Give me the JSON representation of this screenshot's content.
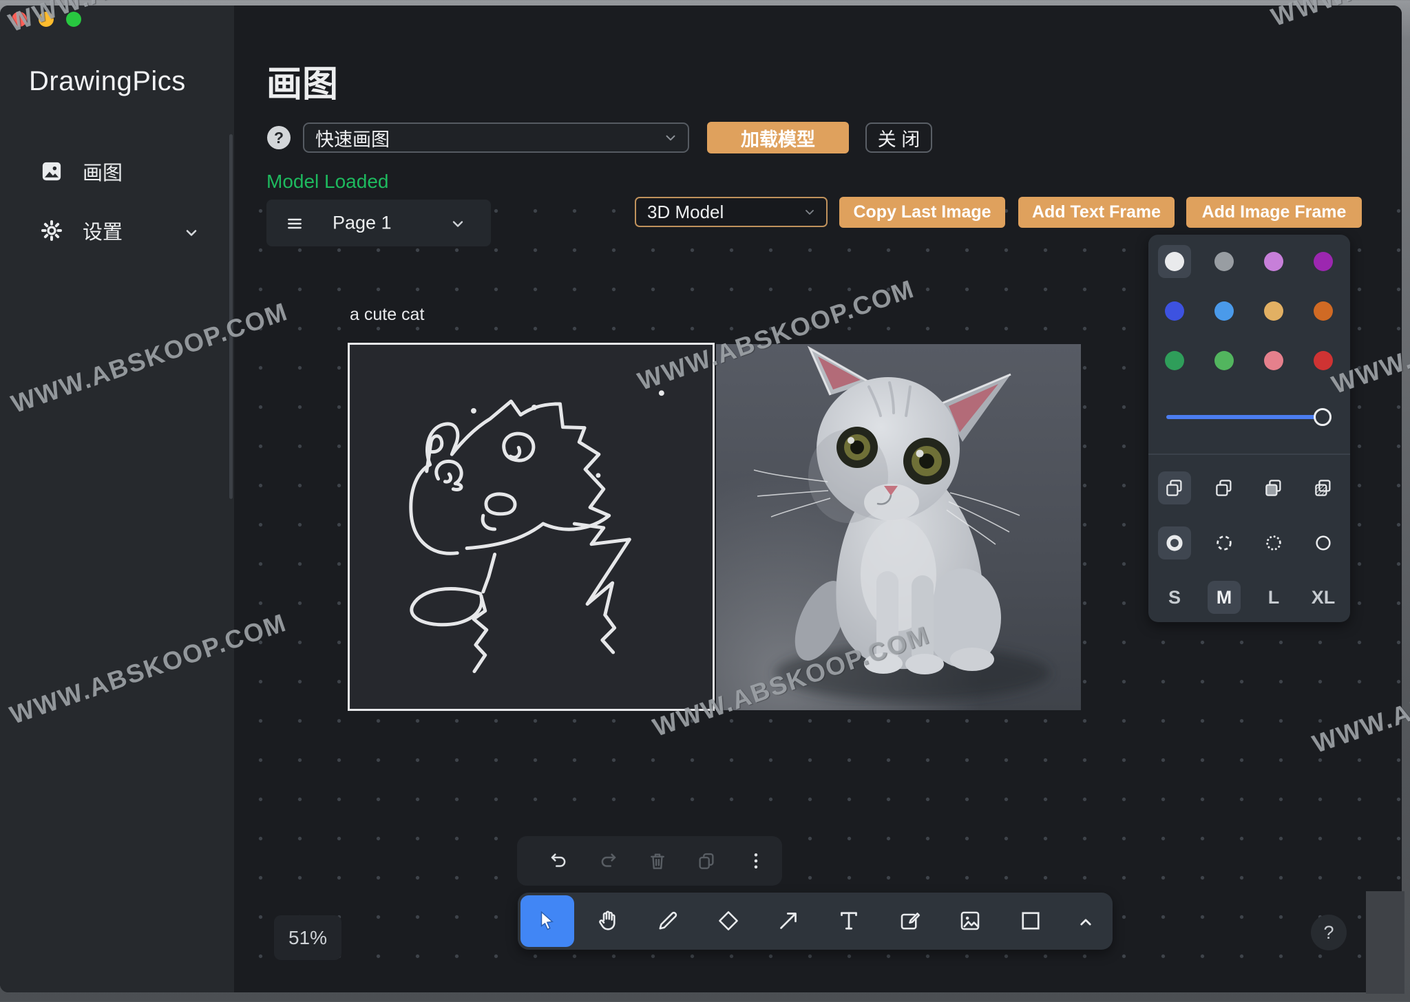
{
  "watermark": {
    "text": "WWW.ABSKOOP.COM"
  },
  "sidebar": {
    "brand": "DrawingPics",
    "items": [
      {
        "label": "画图"
      },
      {
        "label": "设置"
      }
    ]
  },
  "header": {
    "title": "画图",
    "mode_select_value": "快速画图",
    "load_model": "加载模型",
    "close": "关 闭",
    "status": "Model Loaded"
  },
  "pagebar": {
    "page_label": "Page 1",
    "model_select_value": "3D Model",
    "copy_last_image": "Copy Last Image",
    "add_text_frame": "Add Text Frame",
    "add_image_frame": "Add Image Frame"
  },
  "canvas": {
    "prompt": "a cute cat",
    "zoom": "51%"
  },
  "style_panel": {
    "colors": [
      "#e9eaec",
      "#989da2",
      "#c77fd9",
      "#9c27b0",
      "#3d52e0",
      "#4a9aea",
      "#e2b063",
      "#d06a24",
      "#2f9e5a",
      "#52b55e",
      "#e5808c",
      "#cf3333"
    ],
    "selected_color": "#e9eaec",
    "sizes": [
      "S",
      "M",
      "L",
      "XL"
    ],
    "selected_size": "M"
  },
  "help": {
    "label": "?"
  },
  "ui_colors": {
    "accent_orange": "#dfa15d",
    "accent_blue": "#4186f5",
    "status_green": "#1eb95e",
    "slider_blue": "#4b7df0"
  }
}
